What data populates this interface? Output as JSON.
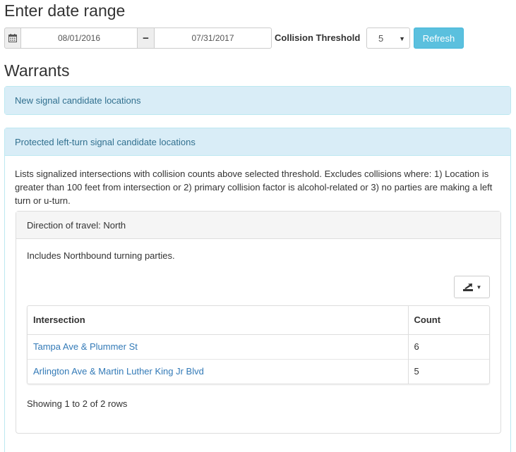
{
  "header": {
    "title": "Enter date range"
  },
  "date_range": {
    "start": "08/01/2016",
    "end": "07/31/2017",
    "separator": "−"
  },
  "threshold": {
    "label": "Collision Threshold",
    "value": "5"
  },
  "refresh_label": "Refresh",
  "warrants_title": "Warrants",
  "panels": {
    "new_signal": {
      "title": "New signal candidate locations"
    },
    "protected_left": {
      "title": "Protected left-turn signal candidate locations",
      "description": "Lists signalized intersections with collision counts above selected threshold. Excludes collisions where: 1) Location is greater than 100 feet from intersection or 2) primary collision factor is alcohol-related or 3) no parties are making a left turn or u-turn.",
      "direction": {
        "title": "Direction of travel: North",
        "includes": "Includes Northbound turning parties.",
        "table": {
          "headers": [
            "Intersection",
            "Count"
          ],
          "rows": [
            {
              "intersection": "Tampa Ave & Plummer St",
              "count": "6"
            },
            {
              "intersection": "Arlington Ave & Martin Luther King Jr Blvd",
              "count": "5"
            }
          ]
        },
        "pagination": "Showing 1 to 2 of 2 rows"
      }
    }
  },
  "colors": {
    "info_bg": "#d9edf7",
    "info_text": "#31708f",
    "refresh_bg": "#5bc0de",
    "link": "#337ab7"
  },
  "icons": [
    "calendar-icon",
    "export-icon",
    "caret-down-icon"
  ]
}
